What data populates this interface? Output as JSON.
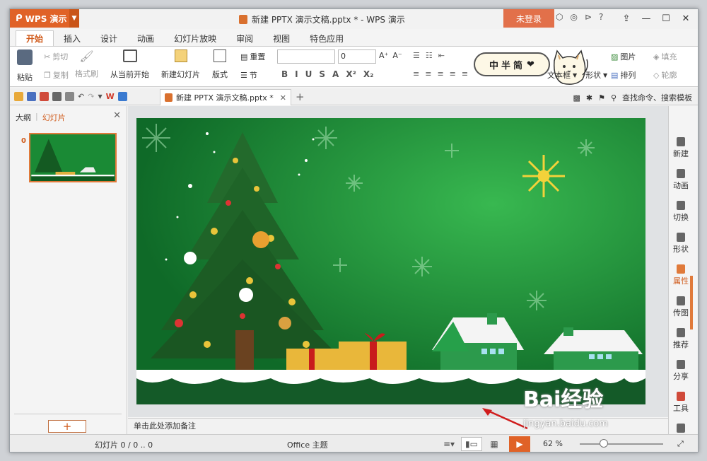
{
  "app": {
    "name": "WPS 演示",
    "window_title": "新建 PPTX 演示文稿.pptx * - WPS 演示",
    "login_label": "未登录"
  },
  "ribbon_tabs": [
    "开始",
    "插入",
    "设计",
    "动画",
    "幻灯片放映",
    "审阅",
    "视图",
    "特色应用"
  ],
  "ribbon": {
    "paste": "粘贴",
    "cut": "剪切",
    "copy": "复制",
    "format_painter": "格式刷",
    "from_current": "从当前开始",
    "new_slide": "新建幻灯片",
    "layout": "版式",
    "reset": "重置",
    "section": "节",
    "font_size": "0",
    "textbox": "文本框",
    "shape": "形状",
    "picture": "图片",
    "arrange": "排列",
    "fill": "填充",
    "outline": "轮廓",
    "format_buttons": [
      "B",
      "I",
      "U",
      "S",
      "A",
      "X²",
      "X₂"
    ]
  },
  "sticker_text": "中半简",
  "doc_tab": {
    "name": "新建 PPTX 演示文稿.pptx *"
  },
  "search_label": "查找命令、搜索模板",
  "left_panel": {
    "outline_tab": "大纲",
    "slides_tab": "幻灯片",
    "thumb_number": "0"
  },
  "notes_placeholder": "单击此处添加备注",
  "right_bar": [
    {
      "label": "新建",
      "icon": "new-icon"
    },
    {
      "label": "动画",
      "icon": "animation-icon"
    },
    {
      "label": "切换",
      "icon": "transition-icon"
    },
    {
      "label": "形状",
      "icon": "shape-icon"
    },
    {
      "label": "属性",
      "icon": "property-icon"
    },
    {
      "label": "传图",
      "icon": "upload-image-icon"
    },
    {
      "label": "推荐",
      "icon": "recommend-icon"
    },
    {
      "label": "分享",
      "icon": "share-icon"
    },
    {
      "label": "工具",
      "icon": "tools-icon"
    },
    {
      "label": "备份",
      "icon": "backup-icon"
    }
  ],
  "status": {
    "slide_info": "幻灯片 0 / 0 .. 0",
    "theme": "Office 主题",
    "zoom": "62 %"
  },
  "watermark": {
    "brand": "Bai经验",
    "url": "jingyan.baidu.com"
  },
  "colors": {
    "accent": "#e06227",
    "slide_green": "#1a8a35"
  }
}
